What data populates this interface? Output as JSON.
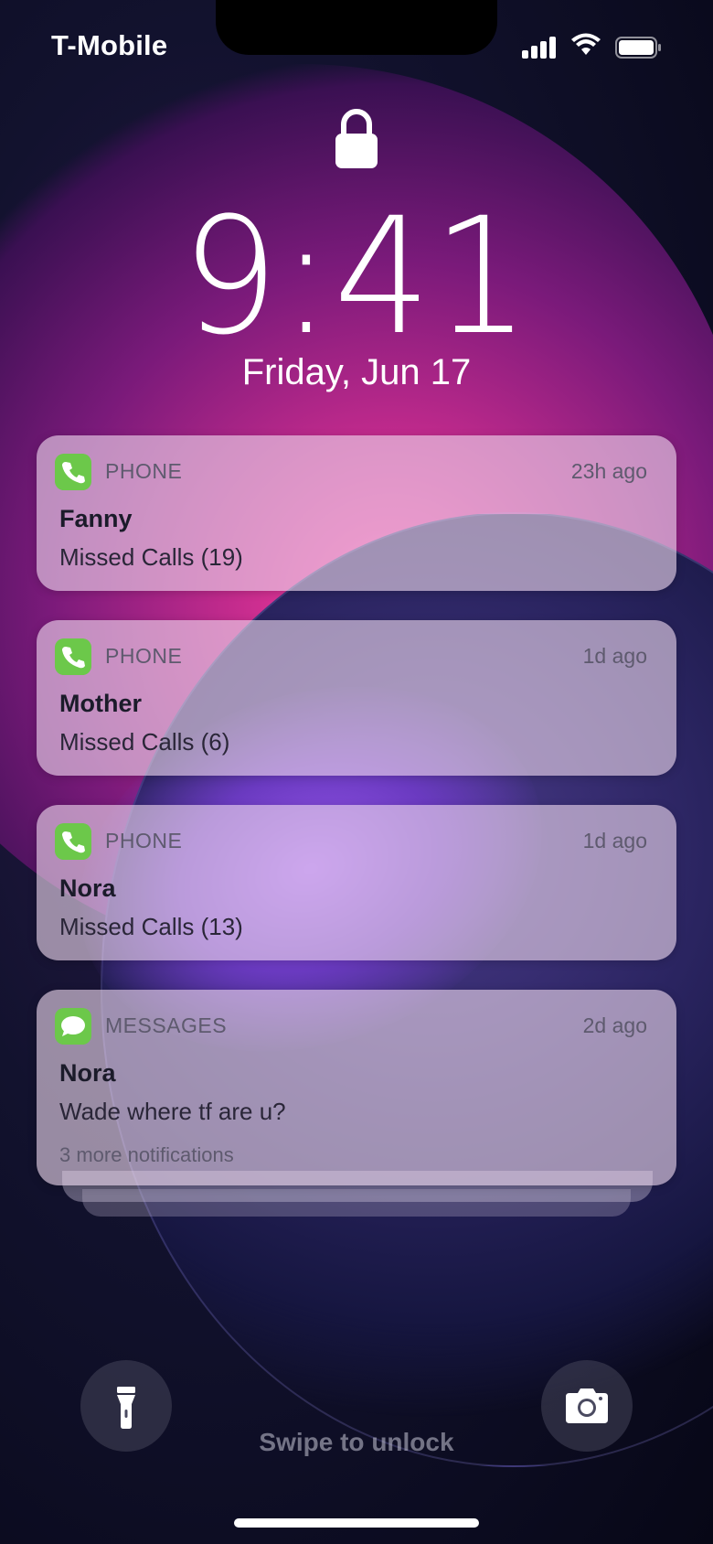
{
  "status_bar": {
    "carrier": "T-Mobile",
    "icons": [
      "signal-icon",
      "wifi-icon",
      "battery-icon"
    ]
  },
  "lock_screen": {
    "time": "9:41",
    "date": "Friday, Jun 17"
  },
  "notifications": [
    {
      "app": "PHONE",
      "time": "23h ago",
      "title": "Fanny",
      "body": "Missed Calls (19)",
      "icon": "phone-app-icon"
    },
    {
      "app": "PHONE",
      "time": "1d ago",
      "title": "Mother",
      "body": "Missed Calls (6)",
      "icon": "phone-app-icon"
    },
    {
      "app": "PHONE",
      "time": "1d ago",
      "title": "Nora",
      "body": "Missed Calls (13)",
      "icon": "phone-app-icon"
    },
    {
      "app": "MESSAGES",
      "time": "2d ago",
      "title": "Nora",
      "body": "Wade where tf are u?",
      "more": "3 more notifications",
      "icon": "messages-app-icon"
    }
  ],
  "bottom": {
    "swipe_text": "Swipe to unlock",
    "flashlight_icon": "flashlight-icon",
    "camera_icon": "camera-icon"
  },
  "colors": {
    "app_icon_green": "#6cc84a",
    "wallpaper_pink": "#ff3fa0",
    "wallpaper_purple": "#3a1052"
  }
}
